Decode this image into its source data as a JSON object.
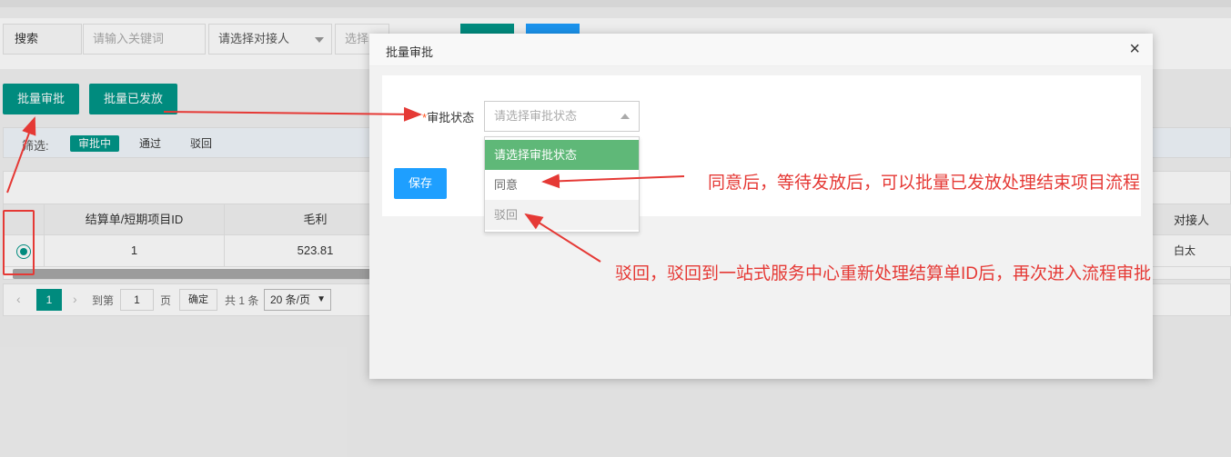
{
  "search": {
    "label": "搜索",
    "keyword_placeholder": "请输入关键词",
    "counterparty_select": "请选择对接人",
    "select2_partial": "选择"
  },
  "toolbar": {
    "batch_approve": "批量审批",
    "batch_issued": "批量已发放"
  },
  "filter": {
    "label": "筛选:",
    "chips": [
      "审批中",
      "通过",
      "驳回"
    ],
    "active_index": 0
  },
  "table": {
    "columns": [
      "结算单/短期项目ID",
      "毛利"
    ],
    "rows": [
      {
        "id": "1",
        "profit": "523.81"
      }
    ],
    "right_col_header_partial": "对接人",
    "right_col_value_partial": "白太"
  },
  "pager": {
    "current": "1",
    "goto_label": "到第",
    "goto_value": "1",
    "page_unit": "页",
    "confirm": "确定",
    "total": "共 1 条",
    "page_size": "20 条/页"
  },
  "modal": {
    "title": "批量审批",
    "close": "×",
    "field_label": "审批状态",
    "required_mark": "*",
    "select_placeholder": "请选择审批状态",
    "options": [
      "请选择审批状态",
      "同意",
      "驳回"
    ],
    "save": "保存"
  },
  "annotations": {
    "agree": "同意后，等待发放后，可以批量已发放处理结束项目流程",
    "reject": "驳回，驳回到一站式服务中心重新处理结算单ID后，再次进入流程审批"
  },
  "colors": {
    "teal": "#009688",
    "blue": "#1e9fff",
    "option_green": "#5fb878",
    "annotation_red": "#e53935"
  }
}
